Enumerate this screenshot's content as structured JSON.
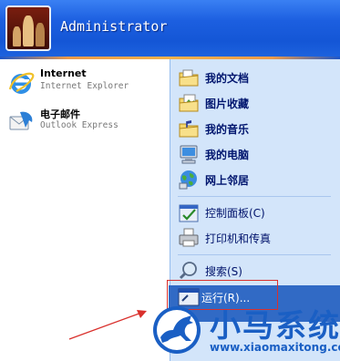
{
  "header": {
    "user_name": "Administrator",
    "avatar_icon": "chess-pieces-avatar"
  },
  "pinned": [
    {
      "title": "Internet",
      "subtitle": "Internet Explorer",
      "icon": "internet-explorer-icon"
    },
    {
      "title": "电子邮件",
      "subtitle": "Outlook Express",
      "icon": "outlook-express-icon"
    }
  ],
  "places": [
    {
      "label": "我的文档",
      "icon": "my-documents-icon"
    },
    {
      "label": "图片收藏",
      "icon": "my-pictures-icon"
    },
    {
      "label": "我的音乐",
      "icon": "my-music-icon"
    },
    {
      "label": "我的电脑",
      "icon": "my-computer-icon"
    },
    {
      "label": "网上邻居",
      "icon": "network-places-icon"
    }
  ],
  "system": [
    {
      "label": "控制面板(C)",
      "icon": "control-panel-icon"
    },
    {
      "label": "打印机和传真",
      "icon": "printer-icon"
    }
  ],
  "search": {
    "label": "搜索(S)",
    "icon": "search-icon"
  },
  "run": {
    "label": "运行(R)...",
    "icon": "run-icon"
  },
  "watermark": {
    "brand": "小马系统",
    "url": "www.xiaomaxitong.com"
  },
  "colors": {
    "accent": "#316ac5",
    "right_pane": "#d3e5fa",
    "annotation": "#d9302c",
    "brand": "#1a5fc4"
  }
}
